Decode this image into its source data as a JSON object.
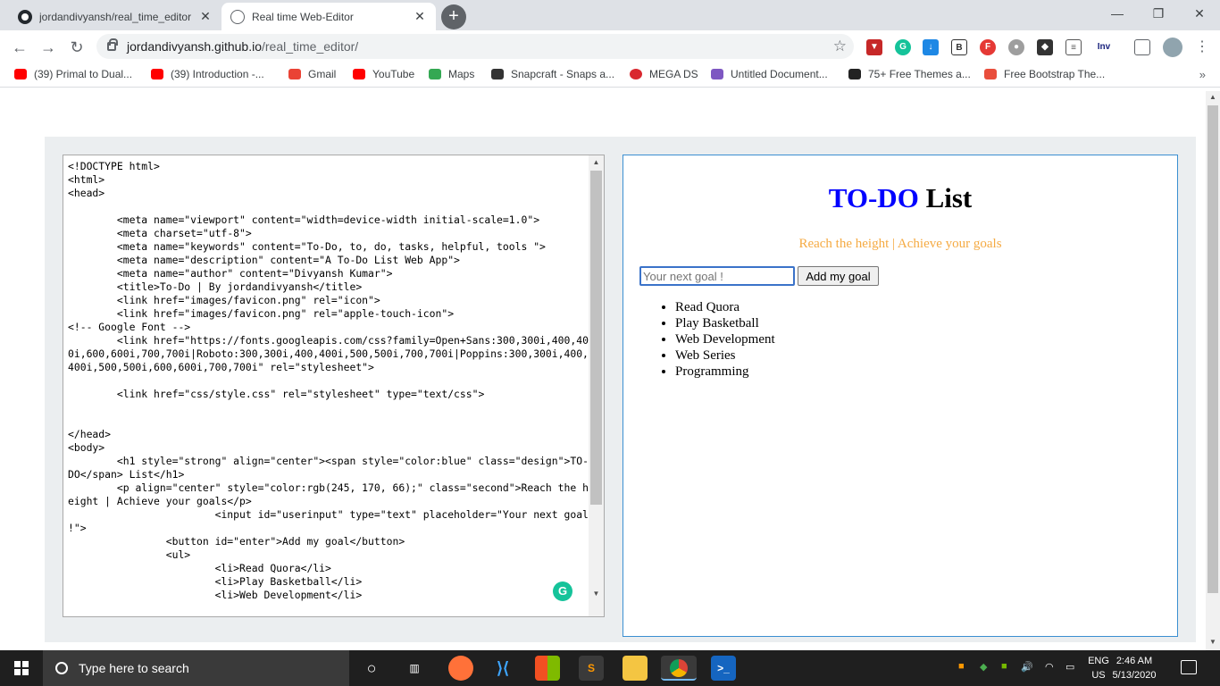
{
  "browser": {
    "tabs": [
      {
        "title": "jordandivyansh/real_time_editor",
        "favicon": "github-icon",
        "active": false
      },
      {
        "title": "Real time Web-Editor",
        "favicon": "globe-icon",
        "active": true
      }
    ],
    "url": {
      "host": "jordandivyansh.github.io",
      "path": "/real_time_editor/"
    },
    "extension_inv_label": "Inv",
    "bookmarks": [
      {
        "label": "(39) Primal to Dual...",
        "color": "#ff0000"
      },
      {
        "label": "(39) Introduction -...",
        "color": "#ff0000"
      },
      {
        "label": "Gmail",
        "color": "#ea4335"
      },
      {
        "label": "YouTube",
        "color": "#ff0000"
      },
      {
        "label": "Maps",
        "color": "#34a853"
      },
      {
        "label": "Snapcraft - Snaps a...",
        "color": "#333333"
      },
      {
        "label": "MEGA DS",
        "color": "#d9272e"
      },
      {
        "label": "Untitled Document...",
        "color": "#7e57c2"
      },
      {
        "label": "75+ Free Themes a...",
        "color": "#222222"
      },
      {
        "label": "Free Bootstrap The...",
        "color": "#e94e3c"
      }
    ],
    "bookmarks_more": "»"
  },
  "editor": {
    "code": "<!DOCTYPE html>\n<html>\n<head>\n\n        <meta name=\"viewport\" content=\"width=device-width initial-scale=1.0\">\n        <meta charset=\"utf-8\">\n        <meta name=\"keywords\" content=\"To-Do, to, do, tasks, helpful, tools \">\n        <meta name=\"description\" content=\"A To-Do List Web App\">\n        <meta name=\"author\" content=\"Divyansh Kumar\">\n        <title>To-Do | By jordandivyansh</title>\n        <link href=\"images/favicon.png\" rel=\"icon\">\n        <link href=\"images/favicon.png\" rel=\"apple-touch-icon\">\n<!-- Google Font -->\n        <link href=\"https://fonts.googleapis.com/css?family=Open+Sans:300,300i,400,400i,600,600i,700,700i|Roboto:300,300i,400,400i,500,500i,700,700i|Poppins:300,300i,400,400i,500,500i,600,600i,700,700i\" rel=\"stylesheet\">\n\n        <link href=\"css/style.css\" rel=\"stylesheet\" type=\"text/css\">\n\n\n</head>\n<body>\n        <h1 style=\"strong\" align=\"center\"><span style=\"color:blue\" class=\"design\">TO-DO</span> List</h1>\n        <p align=\"center\" style=\"color:rgb(245, 170, 66);\" class=\"second\">Reach the height | Achieve your goals</p>\n                        <input id=\"userinput\" type=\"text\" placeholder=\"Your next goal !\">\n                <button id=\"enter\">Add my goal</button>\n                <ul>\n                        <li>Read Quora</li>\n                        <li>Play Basketball</li>\n                        <li>Web Development</li>"
  },
  "preview": {
    "title_blue": "TO-DO",
    "title_rest": " List",
    "subtitle": "Reach the height | Achieve your goals",
    "input_placeholder": "Your next goal !",
    "button_label": "Add my goal",
    "items": [
      "Read Quora",
      "Play Basketball",
      "Web Development",
      "Web Series",
      "Programming"
    ]
  },
  "taskbar": {
    "search_placeholder": "Type here to search",
    "language": "ENG",
    "region": "US",
    "time": "2:46 AM",
    "date": "5/13/2020"
  }
}
